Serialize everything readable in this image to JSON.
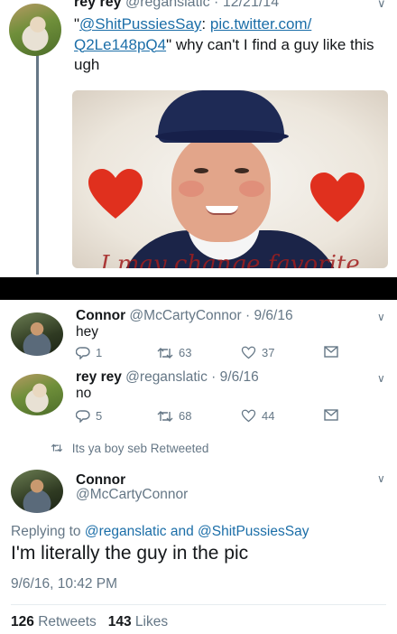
{
  "tweet1": {
    "name": "rey rey",
    "handle": "@reganslatic",
    "date": "12/21/14",
    "text_open": "\"",
    "link1": "@ShitPussiesSay",
    "sep": ": ",
    "link2a": "pic.twitter.com/",
    "link2b": "Q2Le148pQ4",
    "text_close": "\" why can't I find a guy like this ugh",
    "photo_caption": "I may change favorite"
  },
  "reply1": {
    "name": "Connor",
    "handle": "@McCartyConnor",
    "date": "9/6/16",
    "text": "hey",
    "replies": "1",
    "retweets": "63",
    "likes": "37"
  },
  "reply2": {
    "name": "rey rey",
    "handle": "@reganslatic",
    "date": "9/6/16",
    "text": "no",
    "replies": "5",
    "retweets": "68",
    "likes": "44"
  },
  "retweet_notice": "Its ya boy seb Retweeted",
  "main_tweet": {
    "name": "Connor",
    "handle": "@McCartyConnor",
    "replying_prefix": "Replying to ",
    "replying_to": "@reganslatic and @ShitPussiesSay",
    "text": "I'm literally the guy in the pic",
    "timestamp": "9/6/16, 10:42 PM",
    "retweets": "126",
    "retweets_label": "Retweets",
    "likes": "143",
    "likes_label": "Likes"
  },
  "colors": {
    "link": "#1b6ea8",
    "muted": "#657786",
    "heart": "#e0301e"
  }
}
